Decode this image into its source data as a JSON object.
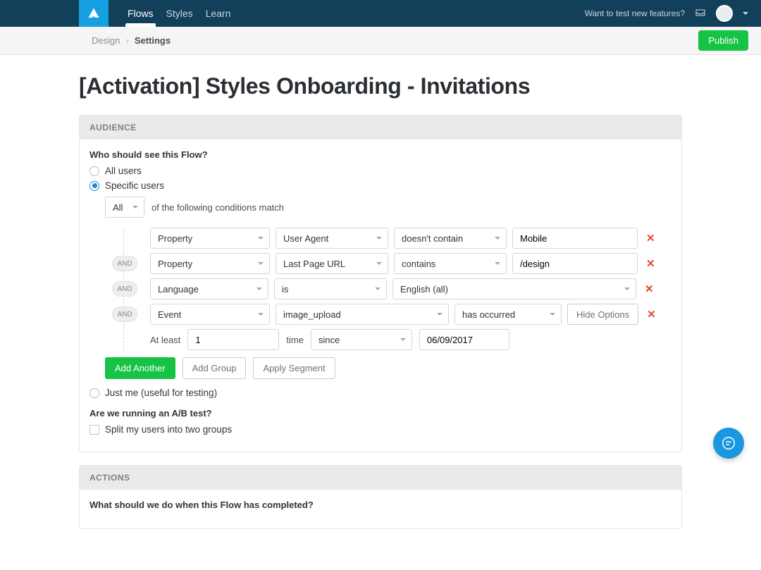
{
  "nav": {
    "tabs": [
      "Flows",
      "Styles",
      "Learn"
    ],
    "promo": "Want to test new features?"
  },
  "breadcrumb": {
    "parent": "Design",
    "current": "Settings"
  },
  "publish": "Publish",
  "title": "[Activation] Styles Onboarding - Invitations",
  "audience": {
    "header": "AUDIENCE",
    "question": "Who should see this Flow?",
    "options": {
      "all": "All users",
      "specific": "Specific users",
      "justme": "Just me (useful for testing)"
    },
    "match": {
      "select": "All",
      "suffix": "of the following conditions match"
    },
    "and": "AND",
    "rows": [
      {
        "type": "Property",
        "field": "User Agent",
        "op": "doesn't contain",
        "val": "Mobile"
      },
      {
        "type": "Property",
        "field": "Last Page URL",
        "op": "contains",
        "val": "/design"
      },
      {
        "type": "Language",
        "field": "is",
        "val": "English (all)"
      },
      {
        "type": "Event",
        "field": "image_upload",
        "op": "has occurred",
        "hide": "Hide Options"
      }
    ],
    "details": {
      "atleast": "At least",
      "count": "1",
      "time": "time",
      "since_label": "since",
      "date": "06/09/2017"
    },
    "buttons": {
      "add_another": "Add Another",
      "add_group": "Add Group",
      "apply_segment": "Apply Segment"
    },
    "ab_question": "Are we running an A/B test?",
    "ab_split": "Split my users into two groups"
  },
  "actions": {
    "header": "ACTIONS",
    "question": "What should we do when this Flow has completed?"
  }
}
